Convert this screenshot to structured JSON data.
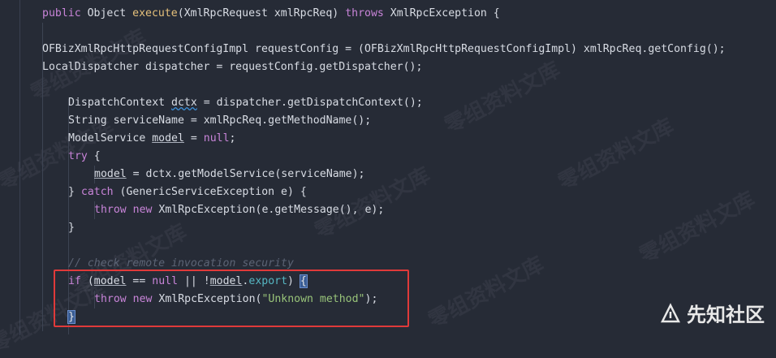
{
  "code": {
    "l1": {
      "kw1": "public",
      "t1": " Object ",
      "fn": "execute",
      "t2": "(XmlRpcRequest xmlRpcReq) ",
      "kw2": "throws",
      "t3": " XmlRpcException {"
    },
    "l2": "OFBizXmlRpcHttpRequestConfigImpl requestConfig = (OFBizXmlRpcHttpRequestConfigImpl) xmlRpcReq.getConfig();",
    "l3": "LocalDispatcher dispatcher = requestConfig.getDispatcher();",
    "l4": {
      "t1": "DispatchContext ",
      "v": "dctx",
      "t2": " = dispatcher.getDispatchContext();"
    },
    "l5": "String serviceName = xmlRpcReq.getMethodName();",
    "l6": {
      "t1": "ModelService ",
      "v": "model",
      "t2": " = ",
      "kw": "null",
      "t3": ";"
    },
    "l7": {
      "kw": "try",
      "t": " {"
    },
    "l8": {
      "v": "model",
      "t": " = dctx.getModelService(serviceName);"
    },
    "l9": {
      "t1": "} ",
      "kw": "catch",
      "t2": " (GenericServiceException e) {"
    },
    "l10": {
      "kw1": "throw",
      "t1": " ",
      "kw2": "new",
      "t2": " XmlRpcException(e.getMessage(), e);"
    },
    "l11": "}",
    "l12": "// check remote invocation security",
    "l13": {
      "kw1": "if",
      "t1": " (",
      "v1": "model",
      "t2": " == ",
      "kw2": "null",
      "t3": " || !",
      "v2": "model",
      "t4": ".",
      "f": "export",
      "t5": ") ",
      "b": "{"
    },
    "l14": {
      "kw1": "throw",
      "t1": " ",
      "kw2": "new",
      "t2": " XmlRpcException(",
      "s": "\"Unknown method\"",
      "t3": ");"
    },
    "l15": "}"
  },
  "watermark": "零组资料文库",
  "brand": {
    "label": "先知社区"
  }
}
